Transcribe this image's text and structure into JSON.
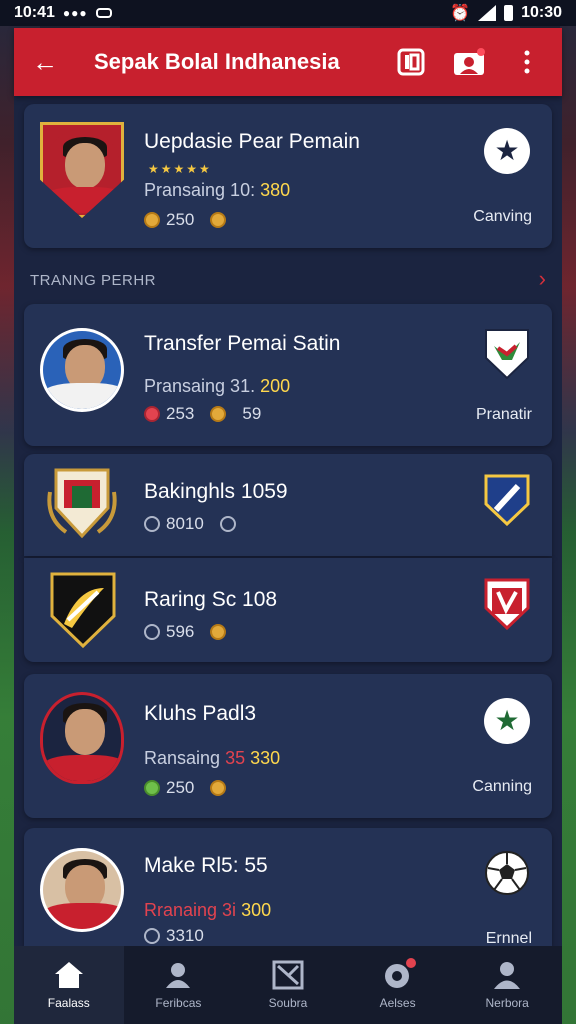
{
  "status_bar": {
    "time_left": "10:41",
    "time_right": "10:30"
  },
  "app_bar": {
    "title": "Sepak Bolal Indhanesia"
  },
  "section": {
    "label": "TRANNG PERHR"
  },
  "cards": [
    {
      "title": "Uepdasie Pear Pemain",
      "stars": "★★★★★",
      "sub_prefix": "Pransaing 10: ",
      "sub_value": "380",
      "meta_1": "250",
      "right_label": "Canving"
    },
    {
      "title": "Transfer Pemai Satin",
      "sub_prefix": "Pransaing 31. ",
      "sub_value": "200",
      "meta_1": "253",
      "meta_2": "59",
      "right_label": "Pranatir"
    },
    {
      "title": "Bakinghls 1059",
      "meta_1": "8010"
    },
    {
      "title": "Raring Sc 108",
      "meta_1": "596"
    },
    {
      "title": "Kluhs Padl3",
      "sub_prefix": "Ransaing ",
      "sub_red": "35 ",
      "sub_value": "330",
      "meta_1": "250",
      "right_label": "Canning"
    },
    {
      "title": "Make Rl5: 55",
      "sub_red": "Rranaing 3i ",
      "sub_value": "300",
      "meta_1": "3310",
      "right_label": "Ernnel"
    }
  ],
  "bottom_nav": [
    {
      "label": "Faalass",
      "icon": "home-icon"
    },
    {
      "label": "Feribcas",
      "icon": "team-icon"
    },
    {
      "label": "Soubra",
      "icon": "scoreboard-icon"
    },
    {
      "label": "Aelses",
      "icon": "ball-icon"
    },
    {
      "label": "Nerbora",
      "icon": "profile-icon"
    }
  ],
  "colors": {
    "accent_red": "#c8202e",
    "card_bg": "#243255",
    "highlight_yellow": "#ffd84d"
  }
}
